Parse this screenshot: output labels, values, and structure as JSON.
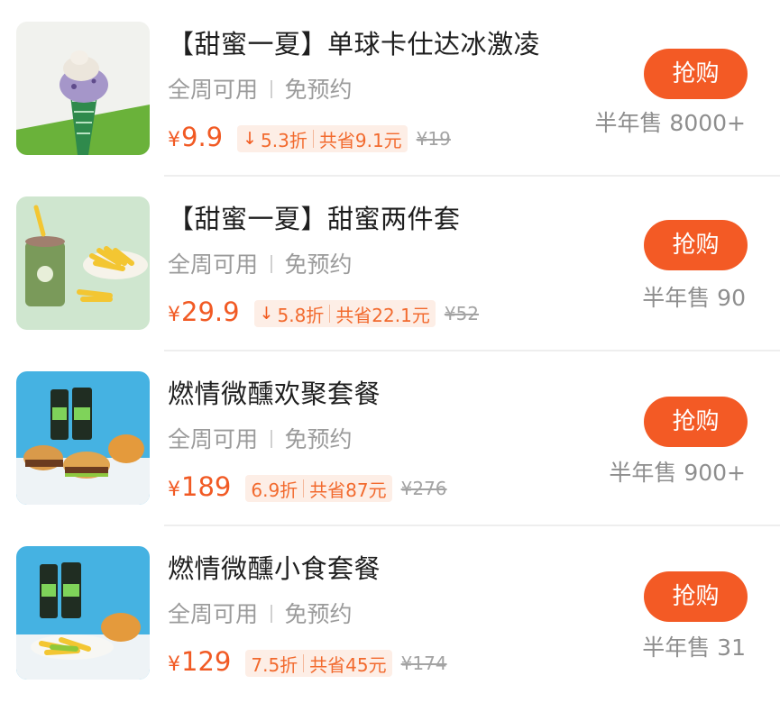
{
  "products": [
    {
      "title": "【甜蜜一夏】单球卡仕达冰激凌",
      "tag1": "全周可用",
      "tag2": "免预约",
      "yen": "¥",
      "price": "9.9",
      "discount_arrow": "↓",
      "discount": "5.3折",
      "saving": "共省9.1元",
      "original_price": "¥19",
      "button": "抢购",
      "sold": "半年售 8000+",
      "image_icon": "ice-cream-cone-photo"
    },
    {
      "title": "【甜蜜一夏】甜蜜两件套",
      "tag1": "全周可用",
      "tag2": "免预约",
      "yen": "¥",
      "price": "29.9",
      "discount_arrow": "↓",
      "discount": "5.8折",
      "saving": "共省22.1元",
      "original_price": "¥52",
      "button": "抢购",
      "sold": "半年售 90",
      "image_icon": "shake-and-fries-photo"
    },
    {
      "title": "燃情微醺欢聚套餐",
      "tag1": "全周可用",
      "tag2": "免预约",
      "yen": "¥",
      "price": "189",
      "discount_arrow": "",
      "discount": "6.9折",
      "saving": "共省87元",
      "original_price": "¥276",
      "button": "抢购",
      "sold": "半年售 900+",
      "image_icon": "beer-and-burgers-photo"
    },
    {
      "title": "燃情微醺小食套餐",
      "tag1": "全周可用",
      "tag2": "免预约",
      "yen": "¥",
      "price": "129",
      "discount_arrow": "",
      "discount": "7.5折",
      "saving": "共省45元",
      "original_price": "¥174",
      "button": "抢购",
      "sold": "半年售 31",
      "image_icon": "beer-and-snacks-photo"
    }
  ],
  "colors": {
    "accent": "#f35a25",
    "price": "#f15a24",
    "discount_bg": "#fdeee6",
    "muted": "#9b9b9b"
  }
}
